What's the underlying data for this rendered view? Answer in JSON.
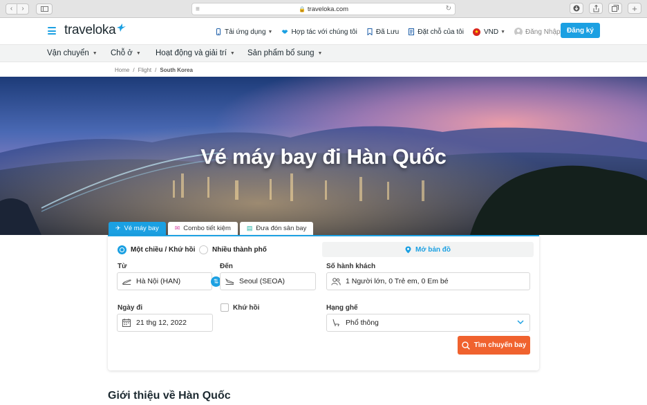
{
  "browser": {
    "url": "traveloka.com"
  },
  "header": {
    "logo": "traveloka",
    "nav": [
      {
        "label": "Tải ứng dụng",
        "icon": "phone-icon"
      },
      {
        "label": "Hợp tác với chúng tôi",
        "icon": "handshake-icon"
      },
      {
        "label": "Đã Lưu",
        "icon": "bookmark-icon"
      },
      {
        "label": "Đặt chỗ của tôi",
        "icon": "receipt-icon"
      }
    ],
    "currency": "VND",
    "login": "Đăng Nhập",
    "signup": "Đăng ký"
  },
  "categories": [
    "Vận chuyển",
    "Chỗ ở",
    "Hoạt động và giải trí",
    "Sản phẩm bổ sung"
  ],
  "breadcrumb": [
    "Home",
    "Flight",
    "South Korea"
  ],
  "hero": {
    "title": "Vé máy bay đi Hàn Quốc"
  },
  "tabs": [
    {
      "label": "Vé máy bay",
      "active": true
    },
    {
      "label": "Combo tiết kiệm",
      "active": false
    },
    {
      "label": "Đưa đón sân bay",
      "active": false
    }
  ],
  "form": {
    "trip_types": [
      {
        "label": "Một chiều / Khứ hồi",
        "selected": true
      },
      {
        "label": "Nhiều thành phố",
        "selected": false
      }
    ],
    "map_label": "Mở bản đồ",
    "from_label": "Từ",
    "from_value": "Hà Nội (HAN)",
    "to_label": "Đến",
    "to_value": "Seoul (SEOA)",
    "passengers_label": "Số hành khách",
    "passengers_value": "1 Người lớn, 0 Trẻ em, 0 Em bé",
    "date_label": "Ngày đi",
    "date_value": "21 thg 12, 2022",
    "return_label": "Khứ hồi",
    "return_checked": false,
    "class_label": "Hạng ghế",
    "class_value": "Phổ thông",
    "search_label": "Tìm chuyến bay"
  },
  "intro_title": "Giới thiệu về Hàn Quốc",
  "colors": {
    "accent": "#1ba0e2",
    "cta": "#f0622e"
  }
}
